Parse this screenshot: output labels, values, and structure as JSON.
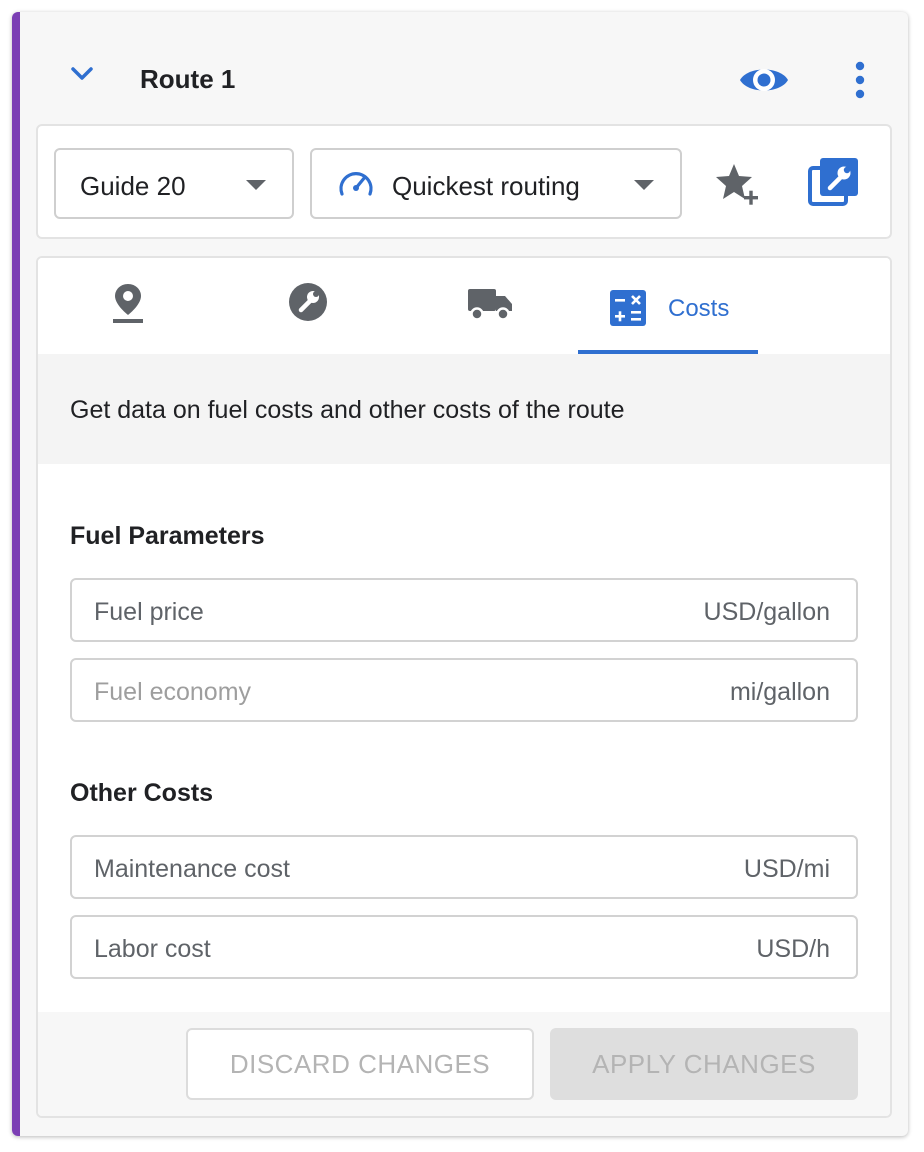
{
  "route": {
    "title": "Route 1"
  },
  "options": {
    "guide_select": "Guide 20",
    "routing_select": "Quickest routing"
  },
  "tabs": [
    {
      "icon": "location-pin-icon"
    },
    {
      "icon": "wrench-icon"
    },
    {
      "icon": "truck-icon"
    },
    {
      "icon": "calculator-icon",
      "label": "Costs",
      "active": true
    }
  ],
  "costs": {
    "description": "Get data on fuel costs and other costs of the route",
    "fuel_section_title": "Fuel Parameters",
    "fuel_price": {
      "label": "Fuel price",
      "unit": "USD/gallon"
    },
    "fuel_economy": {
      "label": "Fuel economy",
      "unit": "mi/gallon"
    },
    "other_section_title": "Other Costs",
    "maintenance_cost": {
      "label": "Maintenance cost",
      "unit": "USD/mi"
    },
    "labor_cost": {
      "label": "Labor cost",
      "unit": "USD/h"
    }
  },
  "footer": {
    "discard_label": "DISCARD CHANGES",
    "apply_label": "APPLY CHANGES"
  },
  "colors": {
    "accent_bar": "#7b3fb4",
    "primary_blue": "#2f6fd0",
    "icon_gray": "#5f6368"
  }
}
